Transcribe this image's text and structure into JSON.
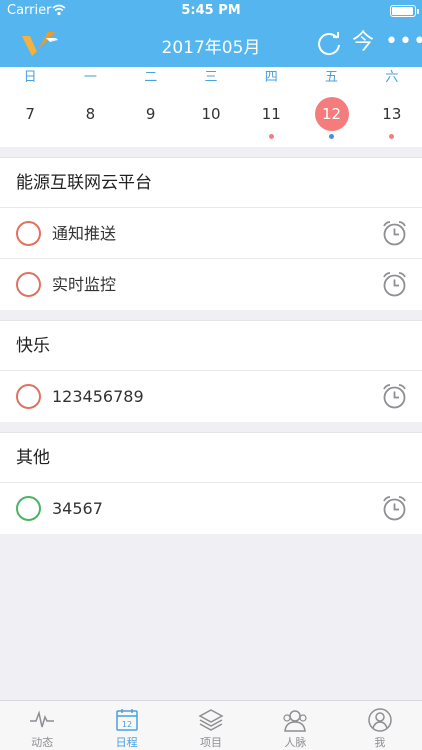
{
  "status_bar": {
    "carrier": "Carrier",
    "time": "5:45 PM"
  },
  "nav": {
    "title": "2017年05月",
    "today_label": "今",
    "more_label": "•••"
  },
  "colors": {
    "header": "#55b5ef",
    "accent": "#4aa2dd",
    "selected_day": "#f57c7c",
    "check_red": "#e0725f",
    "check_green": "#49b55e",
    "dot_red": "#f08080",
    "dot_blue": "#4a90d9"
  },
  "week": {
    "weekdays": [
      "日",
      "一",
      "二",
      "三",
      "四",
      "五",
      "六"
    ],
    "dates": [
      {
        "num": "7",
        "dot": ""
      },
      {
        "num": "8",
        "dot": ""
      },
      {
        "num": "9",
        "dot": ""
      },
      {
        "num": "10",
        "dot": ""
      },
      {
        "num": "11",
        "dot": "red"
      },
      {
        "num": "12",
        "dot": "blue",
        "selected": true
      },
      {
        "num": "13",
        "dot": "red"
      }
    ]
  },
  "groups": [
    {
      "title": "能源互联网云平台",
      "tasks": [
        {
          "label": "通知推送",
          "status": "red"
        },
        {
          "label": "实时监控",
          "status": "red"
        }
      ]
    },
    {
      "title": "快乐",
      "tasks": [
        {
          "label": "123456789",
          "status": "red"
        }
      ]
    },
    {
      "title": "其他",
      "tasks": [
        {
          "label": "34567",
          "status": "green"
        }
      ]
    }
  ],
  "tabbar": {
    "tabs": [
      {
        "label": "动态",
        "icon": "pulse-icon"
      },
      {
        "label": "日程",
        "icon": "calendar-icon",
        "active": true,
        "icon_text": "12"
      },
      {
        "label": "项目",
        "icon": "layers-icon"
      },
      {
        "label": "人脉",
        "icon": "contacts-icon"
      },
      {
        "label": "我",
        "icon": "profile-icon"
      }
    ]
  }
}
